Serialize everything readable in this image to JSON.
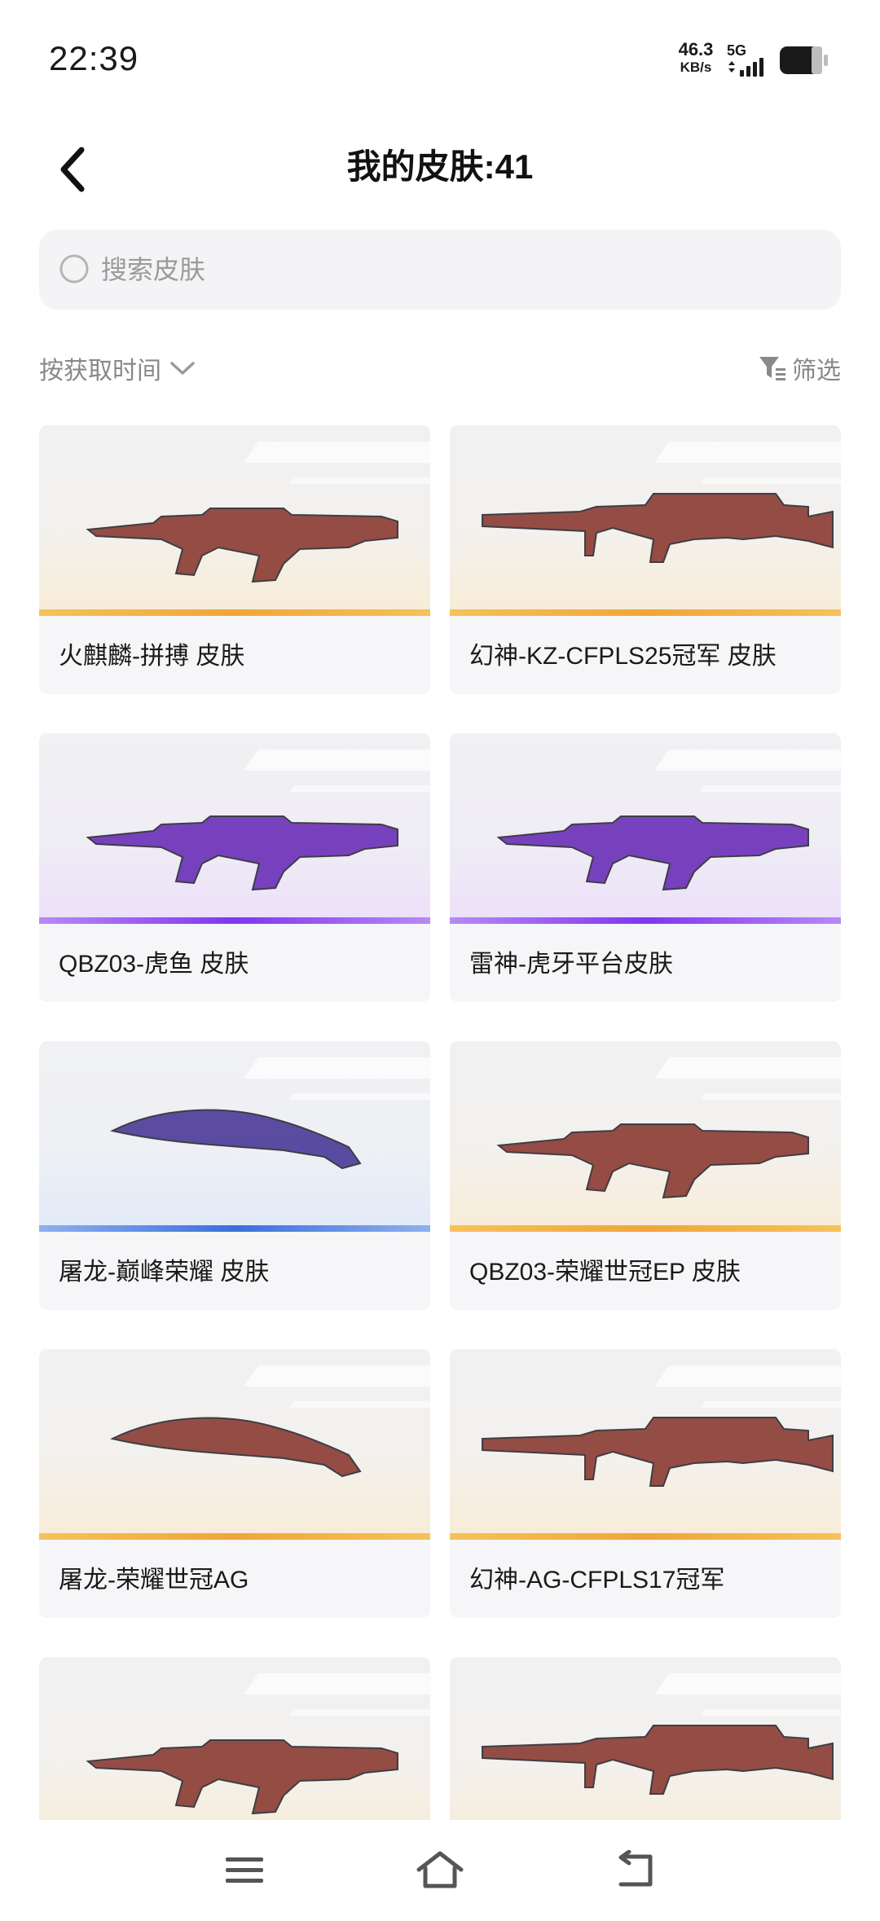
{
  "status_bar": {
    "time": "22:39",
    "net_speed_value": "46.3",
    "net_speed_unit": "KB/s",
    "network_type": "5G",
    "icons": [
      "signal-icon",
      "battery-icon"
    ]
  },
  "header": {
    "back_icon": "chevron-left-icon",
    "title": "我的皮肤:41"
  },
  "search": {
    "placeholder": "搜索皮肤",
    "value": "",
    "icon": "search-icon"
  },
  "sort": {
    "label": "按获取时间",
    "icon": "chevron-down-icon"
  },
  "filter": {
    "label": "筛选",
    "icon": "filter-icon"
  },
  "colors": {
    "gold": "#f2a93b",
    "purple": "#8a3cf0",
    "blue": "#3f74e0",
    "card_bg": "#f6f6f8",
    "search_bg": "#f4f4f6"
  },
  "skins": [
    {
      "name": "火麒麟-拼搏 皮肤",
      "rarity": "gold",
      "weapon_icon": "assault-rifle-icon"
    },
    {
      "name": "幻神-KZ-CFPLS25冠军 皮肤",
      "rarity": "gold",
      "weapon_icon": "sniper-rifle-icon"
    },
    {
      "name": "QBZ03-虎鱼 皮肤",
      "rarity": "purple",
      "weapon_icon": "assault-rifle-icon"
    },
    {
      "name": "雷神-虎牙平台皮肤",
      "rarity": "purple",
      "weapon_icon": "assault-rifle-icon"
    },
    {
      "name": "屠龙-巅峰荣耀 皮肤",
      "rarity": "blue",
      "weapon_icon": "knife-icon"
    },
    {
      "name": "QBZ03-荣耀世冠EP 皮肤",
      "rarity": "gold",
      "weapon_icon": "assault-rifle-icon"
    },
    {
      "name": "屠龙-荣耀世冠AG",
      "rarity": "gold",
      "weapon_icon": "knife-icon"
    },
    {
      "name": "幻神-AG-CFPLS17冠军",
      "rarity": "gold",
      "weapon_icon": "sniper-rifle-icon"
    },
    {
      "name": "",
      "rarity": "gold",
      "weapon_icon": "assault-rifle-icon"
    },
    {
      "name": "",
      "rarity": "gold",
      "weapon_icon": "sniper-rifle-icon"
    }
  ],
  "nav": {
    "icons": [
      "menu-icon",
      "home-icon",
      "back-icon"
    ]
  }
}
